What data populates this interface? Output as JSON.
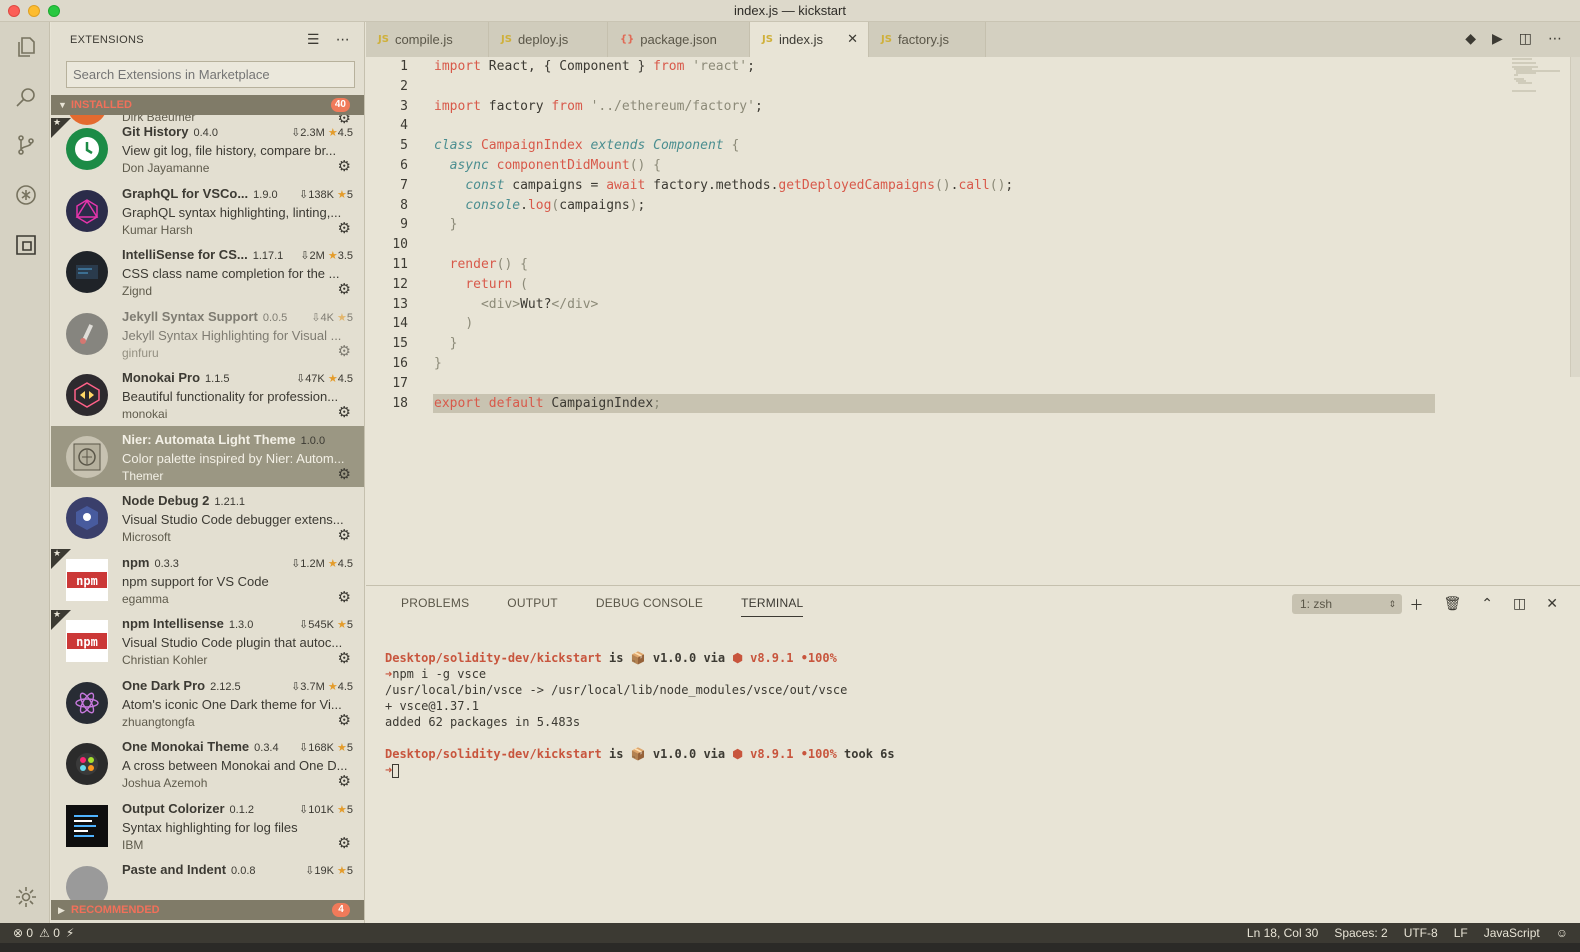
{
  "window": {
    "title": "index.js — kickstart"
  },
  "sidebar": {
    "title": "EXTENSIONS",
    "search_placeholder": "Search Extensions in Marketplace",
    "installed_label": "INSTALLED",
    "installed_count": "40",
    "recommended_label": "RECOMMENDED",
    "recommended_count": "4",
    "partial_top_publisher": "Dirk Baeumer",
    "extensions": [
      {
        "name": "Git History",
        "version": "0.4.0",
        "downloads": "2.3M",
        "rating": "4.5",
        "desc": "View git log, file history, compare br...",
        "publisher": "Don Jayamanne",
        "icon": "git-history-icon",
        "color": "#1c8b46",
        "starred": true
      },
      {
        "name": "GraphQL for VSCo...",
        "version": "1.9.0",
        "downloads": "138K",
        "rating": "5",
        "desc": "GraphQL syntax highlighting, linting,...",
        "publisher": "Kumar Harsh",
        "icon": "graphql-icon",
        "color": "#2b2c4a",
        "starred": false
      },
      {
        "name": "IntelliSense for CS...",
        "version": "1.17.1",
        "downloads": "2M",
        "rating": "3.5",
        "desc": "CSS class name completion for the ...",
        "publisher": "Zignd",
        "icon": "intellisense-css-icon",
        "color": "#1f2328",
        "starred": false
      },
      {
        "name": "Jekyll Syntax Support",
        "version": "0.0.5",
        "downloads": "4K",
        "rating": "5",
        "desc": "Jekyll Syntax Highlighting for Visual ...",
        "publisher": "ginfuru",
        "icon": "jekyll-icon",
        "color": "#4a4a4a",
        "starred": false,
        "disabled": true
      },
      {
        "name": "Monokai Pro",
        "version": "1.1.5",
        "downloads": "47K",
        "rating": "4.5",
        "desc": "Beautiful functionality for profession...",
        "publisher": "monokai",
        "icon": "monokai-pro-icon",
        "color": "#2d2a2e",
        "starred": false
      },
      {
        "name": "Nier: Automata Light Theme",
        "version": "1.0.0",
        "downloads": "",
        "rating": "",
        "desc": "Color palette inspired by Nier: Autom...",
        "publisher": "Themer",
        "icon": "nier-automata-icon",
        "color": "#c7c2b1",
        "starred": false,
        "selected": true
      },
      {
        "name": "Node Debug 2",
        "version": "1.21.1",
        "downloads": "",
        "rating": "",
        "desc": "Visual Studio Code debugger extens...",
        "publisher": "Microsoft",
        "icon": "node-debug-icon",
        "color": "#3a3f6b",
        "starred": false
      },
      {
        "name": "npm",
        "version": "0.3.3",
        "downloads": "1.2M",
        "rating": "4.5",
        "desc": "npm support for VS Code",
        "publisher": "egamma",
        "icon": "npm-icon",
        "color": "#cb3837",
        "starred": true
      },
      {
        "name": "npm Intellisense",
        "version": "1.3.0",
        "downloads": "545K",
        "rating": "5",
        "desc": "Visual Studio Code plugin that autoc...",
        "publisher": "Christian Kohler",
        "icon": "npm-intellisense-icon",
        "color": "#cb3837",
        "starred": true
      },
      {
        "name": "One Dark Pro",
        "version": "2.12.5",
        "downloads": "3.7M",
        "rating": "4.5",
        "desc": "Atom's iconic One Dark theme for Vi...",
        "publisher": "zhuangtongfa",
        "icon": "one-dark-pro-icon",
        "color": "#282c34",
        "starred": false
      },
      {
        "name": "One Monokai Theme",
        "version": "0.3.4",
        "downloads": "168K",
        "rating": "5",
        "desc": "A cross between Monokai and One D...",
        "publisher": "Joshua Azemoh",
        "icon": "one-monokai-icon",
        "color": "#2b2b2b",
        "starred": false
      },
      {
        "name": "Output Colorizer",
        "version": "0.1.2",
        "downloads": "101K",
        "rating": "5",
        "desc": "Syntax highlighting for log files",
        "publisher": "IBM",
        "icon": "output-colorizer-icon",
        "color": "#1c1c1c",
        "starred": false
      },
      {
        "name": "Paste and Indent",
        "version": "0.0.8",
        "downloads": "19K",
        "rating": "5",
        "desc": "",
        "publisher": "",
        "icon": "paste-indent-icon",
        "color": "#9a9a9a",
        "starred": false
      }
    ]
  },
  "tabs": [
    {
      "label": "compile.js",
      "type": "JS"
    },
    {
      "label": "deploy.js",
      "type": "JS"
    },
    {
      "label": "package.json",
      "type": "{}"
    },
    {
      "label": "index.js",
      "type": "JS",
      "active": true
    },
    {
      "label": "factory.js",
      "type": "JS"
    }
  ],
  "editor": {
    "lines": [
      "1",
      "2",
      "3",
      "4",
      "5",
      "6",
      "7",
      "8",
      "9",
      "10",
      "11",
      "12",
      "13",
      "14",
      "15",
      "16",
      "17",
      "18"
    ]
  },
  "panel": {
    "tabs": [
      "PROBLEMS",
      "OUTPUT",
      "DEBUG CONSOLE",
      "TERMINAL"
    ],
    "active_tab": "TERMINAL",
    "terminal_select": "1: zsh",
    "lines": {
      "prompt1_path": "Desktop/solidity-dev/kickstart",
      "is": "is",
      "pkg_version": "v1.0.0",
      "via": "via",
      "node_version": "v8.9.1",
      "battery": "•100%",
      "cmd1": "npm i -g vsce",
      "out1": "/usr/local/bin/vsce -> /usr/local/lib/node_modules/vsce/out/vsce",
      "out2": "+ vsce@1.37.1",
      "out3": "added 62 packages in 5.483s",
      "took": "took 6s"
    }
  },
  "status": {
    "errors": "0",
    "warnings": "0",
    "position": "Ln 18, Col 30",
    "spaces": "Spaces: 2",
    "encoding": "UTF-8",
    "eol": "LF",
    "language": "JavaScript"
  }
}
